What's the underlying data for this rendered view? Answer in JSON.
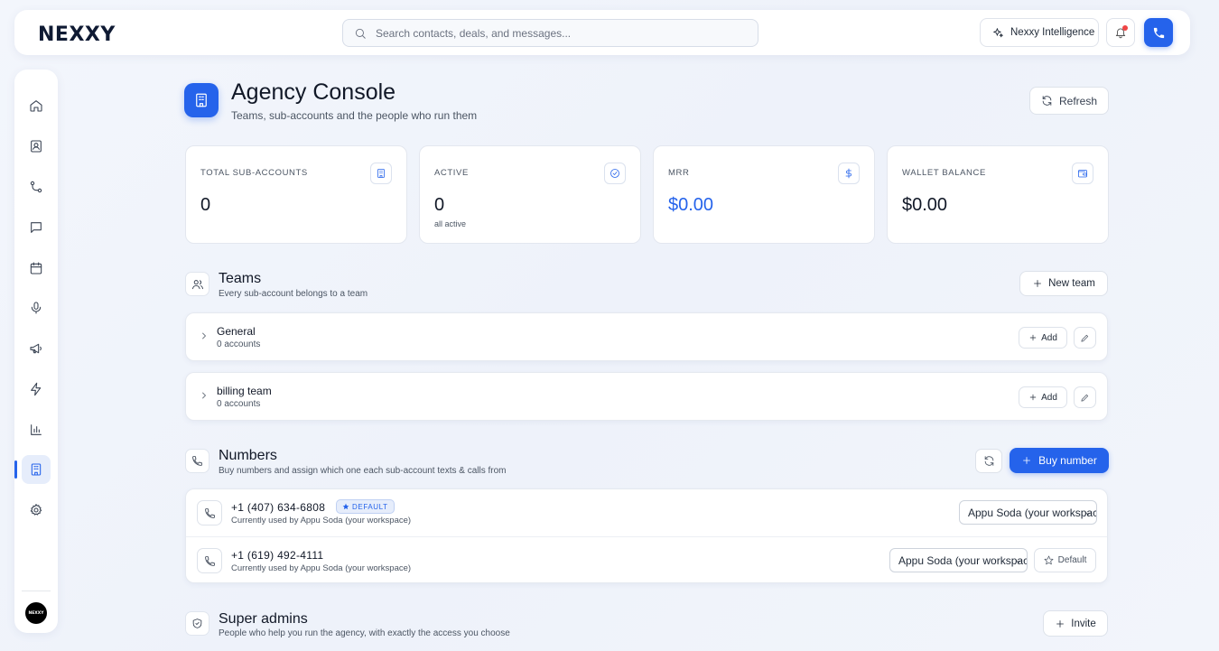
{
  "app": {
    "logo": "NEXXY"
  },
  "search": {
    "placeholder": "Search contacts, deals, and messages..."
  },
  "topbar": {
    "ai_label": "Nexxy Intelligence"
  },
  "sidebar": {
    "items": [
      {
        "icon": "home-icon"
      },
      {
        "icon": "contacts-icon"
      },
      {
        "icon": "pipeline-icon"
      },
      {
        "icon": "messages-icon"
      },
      {
        "icon": "calendar-icon"
      },
      {
        "icon": "microphone-icon"
      },
      {
        "icon": "megaphone-icon"
      },
      {
        "icon": "lightning-icon"
      },
      {
        "icon": "chart-icon"
      },
      {
        "icon": "building-icon",
        "active": true
      },
      {
        "icon": "gear-icon"
      }
    ],
    "avatar_text": "NEXXY"
  },
  "header": {
    "title": "Agency Console",
    "subtitle": "Teams, sub-accounts and the people who run them",
    "refresh_label": "Refresh"
  },
  "stats": [
    {
      "label": "TOTAL SUB-ACCOUNTS",
      "value": "0",
      "sub": "",
      "icon": "building-icon"
    },
    {
      "label": "ACTIVE",
      "value": "0",
      "sub": "all active",
      "icon": "check-circle-icon"
    },
    {
      "label": "MRR",
      "value": "$0.00",
      "sub": "",
      "icon": "dollar-icon"
    },
    {
      "label": "WALLET BALANCE",
      "value": "$0.00",
      "sub": "",
      "icon": "wallet-icon"
    }
  ],
  "teams": {
    "title": "Teams",
    "subtitle": "Every sub-account belongs to a team",
    "new_label": "New team",
    "add_label": "Add",
    "rows": [
      {
        "name": "General",
        "count": "0 accounts"
      },
      {
        "name": "billing team",
        "count": "0 accounts"
      }
    ]
  },
  "numbers": {
    "title": "Numbers",
    "subtitle": "Buy numbers and assign which one each sub-account texts & calls from",
    "buy_label": "Buy number",
    "default_badge": "DEFAULT",
    "default_button": "Default",
    "rows": [
      {
        "phone": "+1 (407) 634-6808",
        "used_by": "Currently used by Appu Soda (your workspace)",
        "selected": "Appu Soda (your workspace)",
        "is_default": true
      },
      {
        "phone": "+1 (619) 492-4111",
        "used_by": "Currently used by Appu Soda (your workspace)",
        "selected": "Appu Soda (your workspace)",
        "is_default": false
      }
    ]
  },
  "super_admins": {
    "title": "Super admins",
    "subtitle": "People who help you run the agency, with exactly the access you choose",
    "invite_label": "Invite"
  },
  "colors": {
    "accent": "#2563eb",
    "badge_alert": "#ef4444"
  }
}
